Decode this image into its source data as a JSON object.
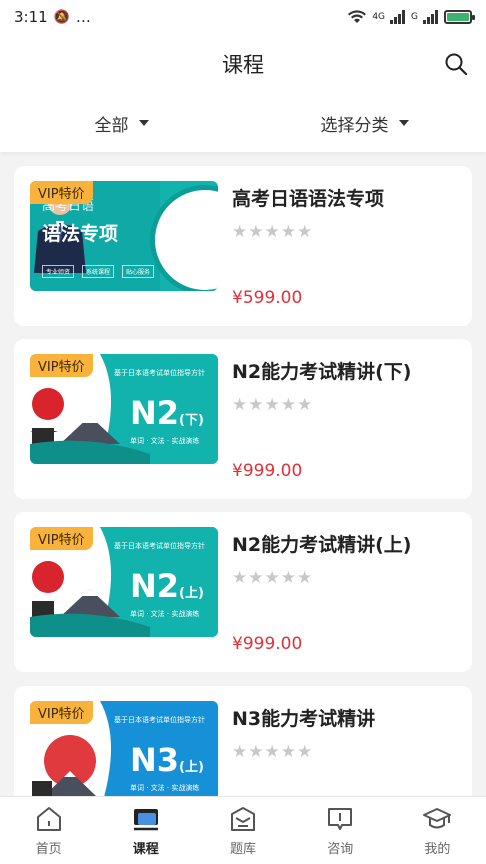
{
  "status_bar": {
    "time": "3:11",
    "extra": "…",
    "net1": "4G",
    "net2": "G"
  },
  "header": {
    "title": "课程"
  },
  "filters": [
    {
      "label": "全部"
    },
    {
      "label": "选择分类"
    }
  ],
  "courses": [
    {
      "badge": "VIP特价",
      "title": "高考日语语法专项",
      "rating_stars": 0,
      "price": "¥599.00",
      "thumb": {
        "sub": "高考日语",
        "main": "语法专项",
        "tags": [
          "专业师资",
          "系统课程",
          "贴心服务"
        ]
      }
    },
    {
      "badge": "VIP特价",
      "title": "N2能力考试精讲(下)",
      "rating_stars": 0,
      "price": "¥999.00",
      "thumb": {
        "top": "基于日本语考试单位指导方针",
        "big": "N2",
        "suffix": "(下)",
        "bottom": "单词 · 文法 · 实战演练"
      }
    },
    {
      "badge": "VIP特价",
      "title": "N2能力考试精讲(上)",
      "rating_stars": 0,
      "price": "¥999.00",
      "thumb": {
        "top": "基于日本语考试单位指导方针",
        "big": "N2",
        "suffix": "(上)",
        "bottom": "单词 · 文法 · 实战演练"
      }
    },
    {
      "badge": "VIP特价",
      "title": "N3能力考试精讲",
      "rating_stars": 0,
      "price": "",
      "thumb": {
        "top": "基于日本语考试单位指导方针",
        "big": "N3",
        "suffix": "(上)",
        "bottom": "单词 · 文法 · 实战演练"
      }
    }
  ],
  "stars_text": "★★★★★",
  "tabbar": [
    {
      "label": "首页",
      "icon": "home-icon",
      "active": false
    },
    {
      "label": "课程",
      "icon": "course-icon",
      "active": true
    },
    {
      "label": "题库",
      "icon": "question-bank-icon",
      "active": false
    },
    {
      "label": "咨询",
      "icon": "consult-icon",
      "active": false
    },
    {
      "label": "我的",
      "icon": "profile-icon",
      "active": false
    }
  ],
  "colors": {
    "price": "#e0313a",
    "vip_badge": "#f9b23b",
    "teal": "#12b3ad",
    "blue": "#1690d6"
  }
}
